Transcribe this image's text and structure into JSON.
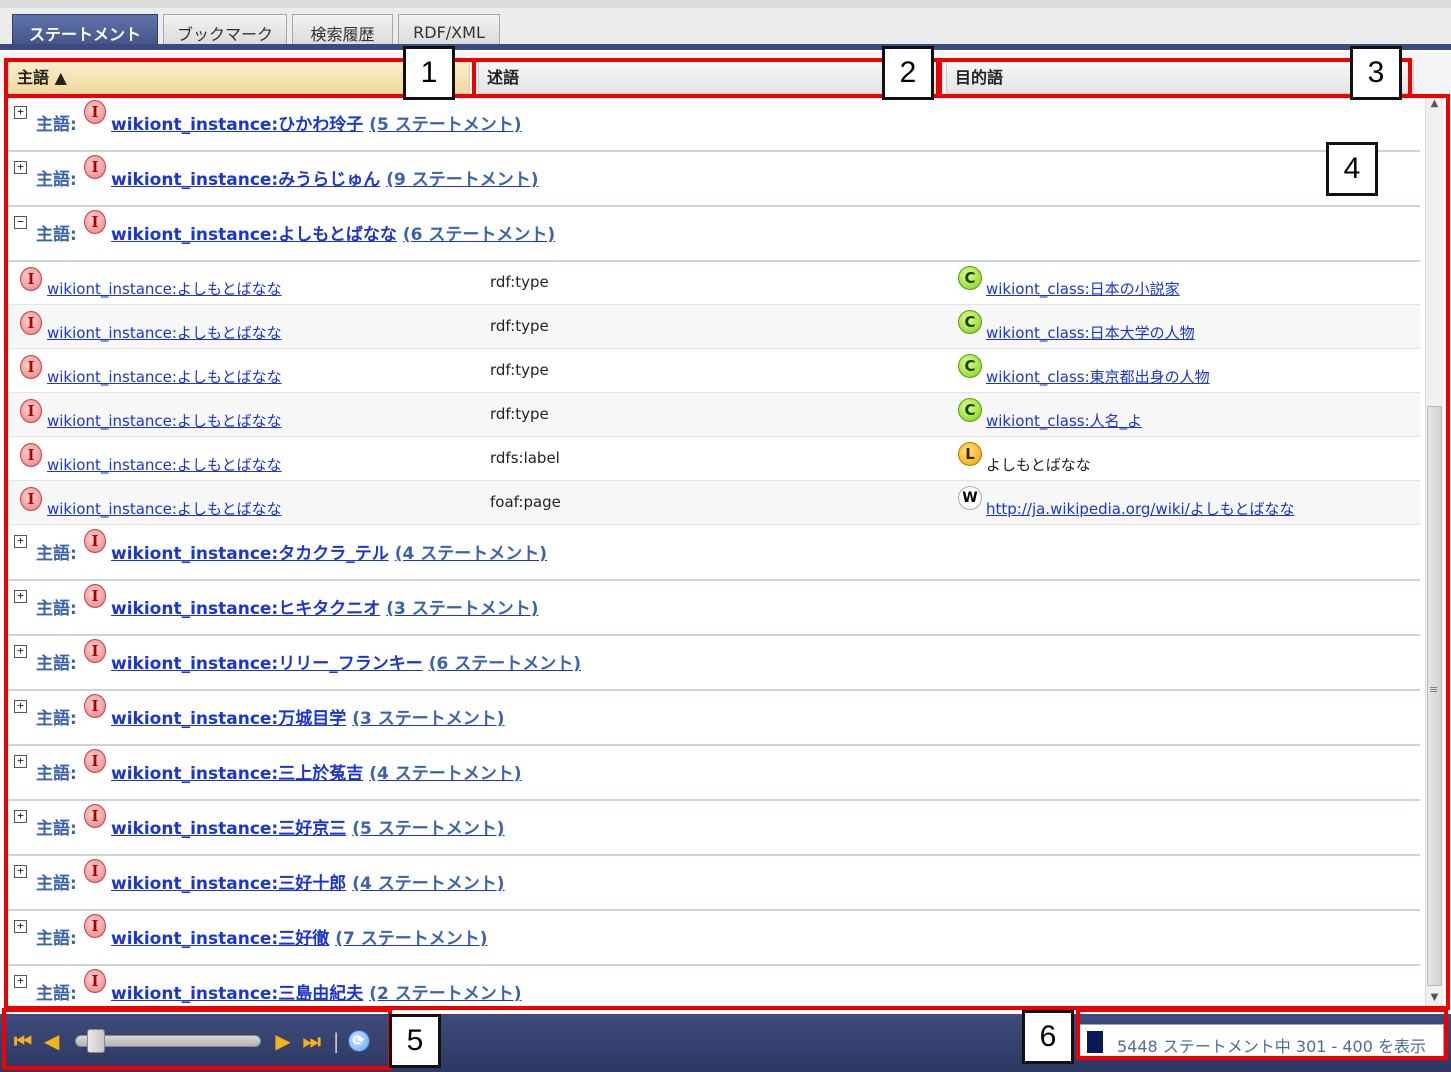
{
  "tabs": [
    {
      "label": "ステートメント",
      "active": true
    },
    {
      "label": "ブックマーク",
      "active": false
    },
    {
      "label": "検索履歴",
      "active": false
    },
    {
      "label": "RDF/XML",
      "active": false
    }
  ],
  "columns": {
    "subject": "主語 ▲",
    "predicate": "述語",
    "object": "目的語"
  },
  "group_prefix": "主語:",
  "groups_before": [
    {
      "expander": "+",
      "instance": "wikiont_instance:ひかわ玲子",
      "count": "(5 ステートメント)"
    },
    {
      "expander": "+",
      "instance": "wikiont_instance:みうらじゅん",
      "count": "(9 ステートメント)"
    },
    {
      "expander": "−",
      "instance": "wikiont_instance:よしもとばなな",
      "count": "(6 ステートメント)"
    }
  ],
  "statements": [
    {
      "subject": "wikiont_instance:よしもとばなな",
      "predicate": "rdf:type",
      "object_icon": "C",
      "object": "wikiont_class:日本の小説家",
      "object_is_link": true
    },
    {
      "subject": "wikiont_instance:よしもとばなな",
      "predicate": "rdf:type",
      "object_icon": "C",
      "object": "wikiont_class:日本大学の人物",
      "object_is_link": true
    },
    {
      "subject": "wikiont_instance:よしもとばなな",
      "predicate": "rdf:type",
      "object_icon": "C",
      "object": "wikiont_class:東京都出身の人物",
      "object_is_link": true
    },
    {
      "subject": "wikiont_instance:よしもとばなな",
      "predicate": "rdf:type",
      "object_icon": "C",
      "object": "wikiont_class:人名_よ",
      "object_is_link": true
    },
    {
      "subject": "wikiont_instance:よしもとばなな",
      "predicate": "rdfs:label",
      "object_icon": "L",
      "object": "よしもとばなな",
      "object_is_link": false
    },
    {
      "subject": "wikiont_instance:よしもとばなな",
      "predicate": "foaf:page",
      "object_icon": "W",
      "object": "http://ja.wikipedia.org/wiki/よしもとばなな",
      "object_is_link": true
    }
  ],
  "groups_after": [
    {
      "expander": "+",
      "instance": "wikiont_instance:タカクラ_テル",
      "count": "(4 ステートメント)"
    },
    {
      "expander": "+",
      "instance": "wikiont_instance:ヒキタクニオ",
      "count": "(3 ステートメント)"
    },
    {
      "expander": "+",
      "instance": "wikiont_instance:リリー_フランキー",
      "count": "(6 ステートメント)"
    },
    {
      "expander": "+",
      "instance": "wikiont_instance:万城目学",
      "count": "(3 ステートメント)"
    },
    {
      "expander": "+",
      "instance": "wikiont_instance:三上於菟吉",
      "count": "(4 ステートメント)"
    },
    {
      "expander": "+",
      "instance": "wikiont_instance:三好京三",
      "count": "(5 ステートメント)"
    },
    {
      "expander": "+",
      "instance": "wikiont_instance:三好十郎",
      "count": "(4 ステートメント)"
    },
    {
      "expander": "+",
      "instance": "wikiont_instance:三好徹",
      "count": "(7 ステートメント)"
    },
    {
      "expander": "+",
      "instance": "wikiont_instance:三島由紀夫",
      "count": "(2 ステートメント)"
    }
  ],
  "icons": {
    "instance": "I",
    "class": "C",
    "literal": "L",
    "web": "W"
  },
  "pager": {
    "first": "⏮",
    "prev": "◀",
    "next": "▶",
    "last": "⏭",
    "separator": "|",
    "refresh": "⟳",
    "position_fraction": 0.06
  },
  "status": {
    "text": "5448 ステートメント中 301 - 400 を表示"
  },
  "annotations": [
    "1",
    "2",
    "3",
    "4",
    "5",
    "6"
  ],
  "colors": {
    "highlight": "#ee0000",
    "tab_active": "#3f4f86",
    "link": "#1a35d0",
    "group_text": "#3b63ad"
  }
}
